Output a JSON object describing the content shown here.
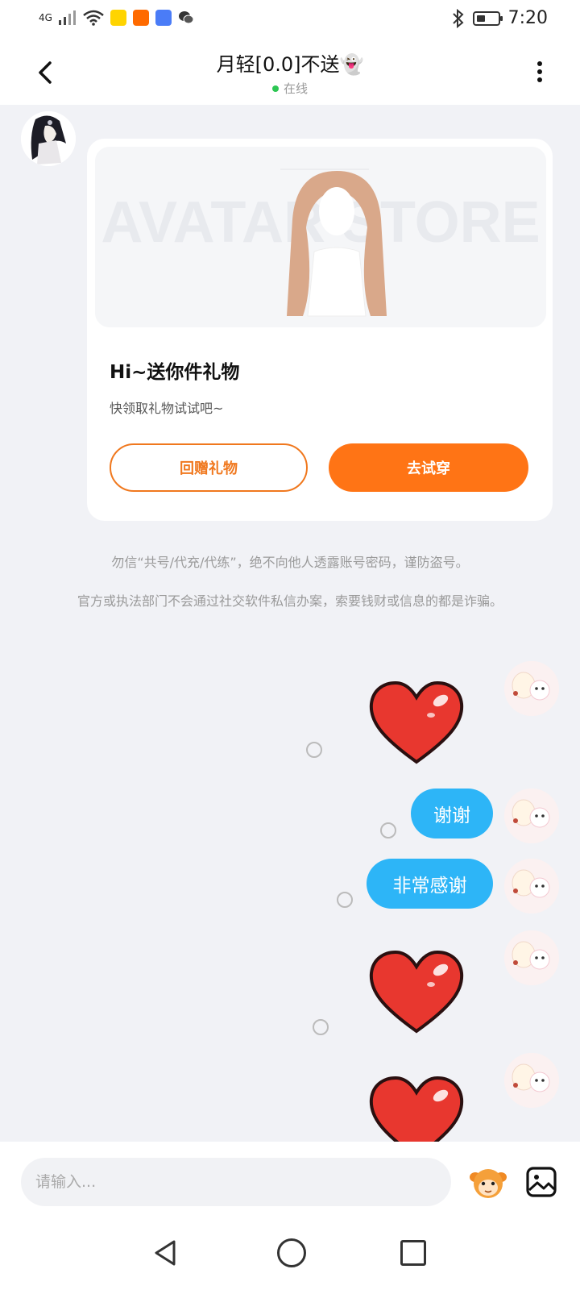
{
  "status_bar": {
    "network": "4G",
    "time": "7:20",
    "icons": [
      "signal-icon",
      "wifi-icon",
      "app-icon-yellow",
      "app-icon-orange",
      "app-icon-blue",
      "wechat-icon",
      "bluetooth-icon",
      "battery-icon"
    ]
  },
  "header": {
    "title": "月轻[0.0]不送👻",
    "status": "在线"
  },
  "gift_card": {
    "image_watermark": "AVATAR STORE",
    "title": "Hi~送你件礼物",
    "subtitle": "快领取礼物试试吧~",
    "return_gift_label": "回赠礼物",
    "try_on_label": "去试穿"
  },
  "notices": [
    "勿信“共号/代充/代练”，绝不向他人透露账号密码，谨防盗号。",
    "官方或执法部门不会通过社交软件私信办案，索要钱财或信息的都是诈骗。"
  ],
  "messages": [
    {
      "type": "sticker",
      "icon": "heart-sticker"
    },
    {
      "type": "text",
      "text": "谢谢"
    },
    {
      "type": "text",
      "text": "非常感谢"
    },
    {
      "type": "sticker",
      "icon": "heart-sticker"
    },
    {
      "type": "sticker",
      "icon": "heart-sticker"
    }
  ],
  "input_bar": {
    "placeholder": "请输入..."
  },
  "colors": {
    "accent_orange": "#ff7415",
    "bubble_blue": "#2db5f7",
    "online_green": "#2dc653",
    "background": "#f1f2f6"
  }
}
